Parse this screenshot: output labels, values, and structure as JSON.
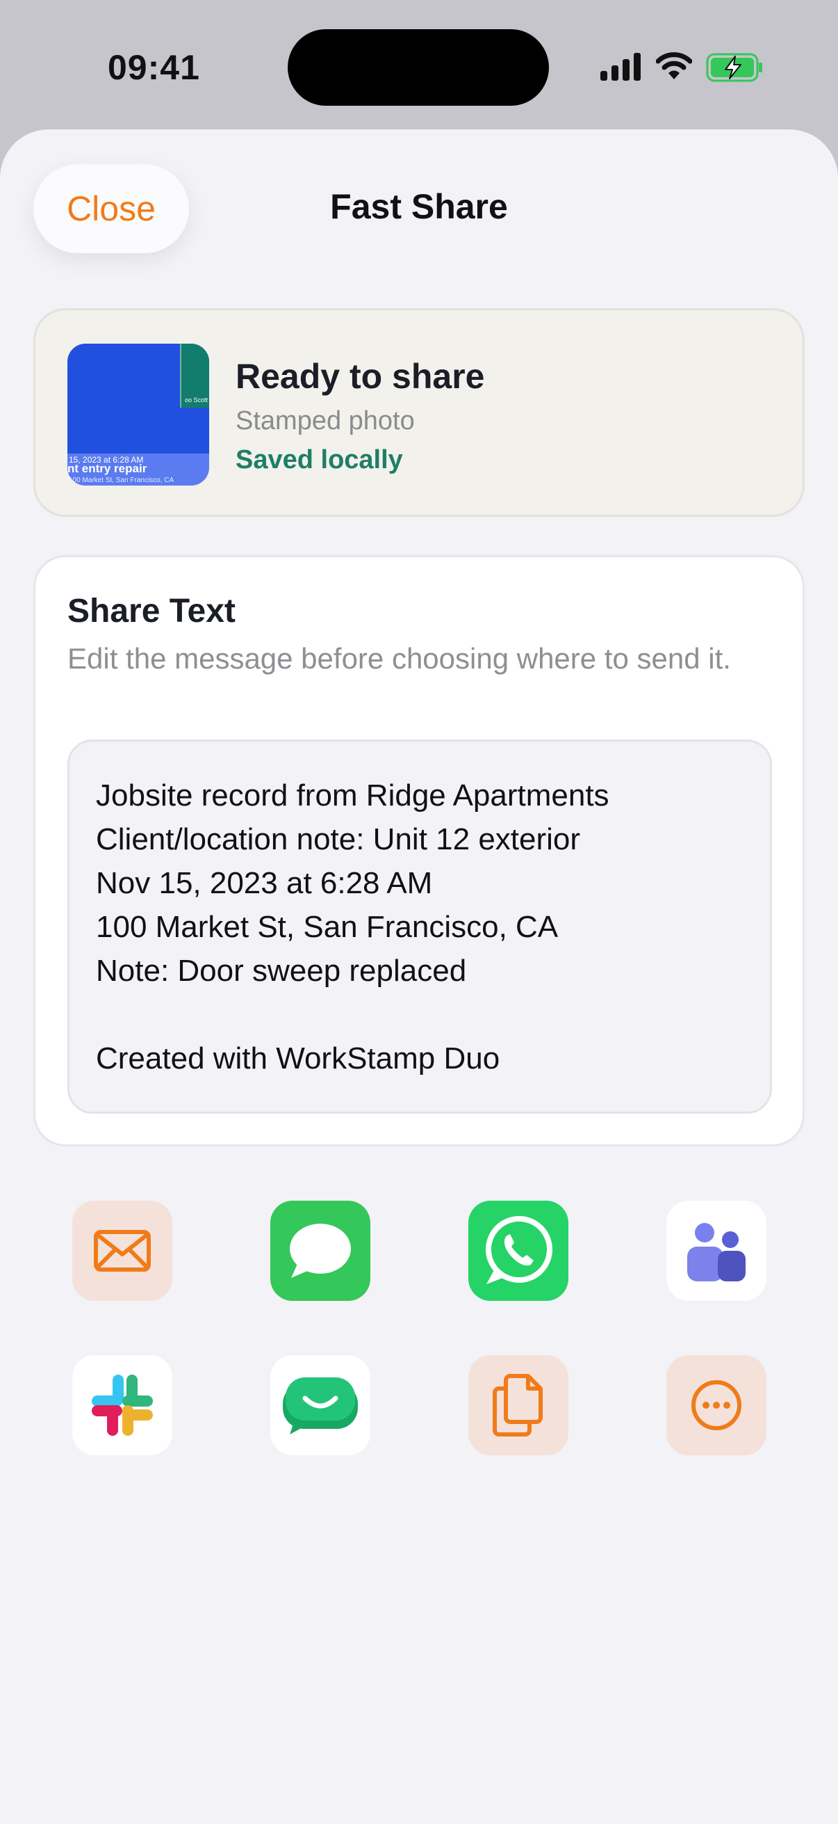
{
  "status_bar": {
    "time": "09:41"
  },
  "header": {
    "close_label": "Close",
    "title": "Fast Share"
  },
  "ready_card": {
    "title": "Ready to share",
    "subtitle": "Stamped photo",
    "status": "Saved locally",
    "thumbnail": {
      "date_text": "15, 2023 at 6:28 AM",
      "title_text": "nt entry repair",
      "address_text": "100 Market St, San Francisco, CA",
      "side_text": "oo Scott"
    }
  },
  "share_text": {
    "heading": "Share Text",
    "hint": "Edit the message before choosing where to send it.",
    "message": "Jobsite record from Ridge Apartments\nClient/location note: Unit 12 exterior\nNov 15, 2023 at 6:28 AM\n100 Market St, San Francisco, CA\nNote: Door sweep replaced\n\nCreated with WorkStamp Duo"
  },
  "share_targets": [
    {
      "icon": "mail-icon"
    },
    {
      "icon": "messages-icon"
    },
    {
      "icon": "whatsapp-icon"
    },
    {
      "icon": "teams-icon"
    },
    {
      "icon": "slack-icon"
    },
    {
      "icon": "chat-app-icon"
    },
    {
      "icon": "copy-icon"
    },
    {
      "icon": "more-icon"
    }
  ],
  "colors": {
    "accent": "#f07b1a",
    "success": "#1e7e66",
    "background": "#f2f2f7"
  }
}
